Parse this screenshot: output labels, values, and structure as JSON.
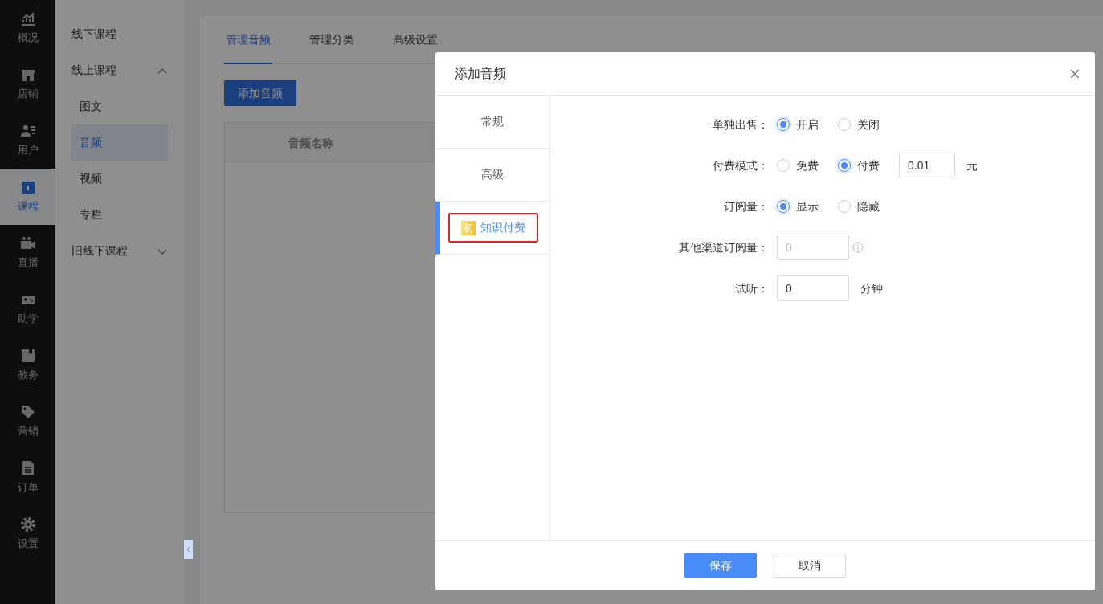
{
  "nav_rail": {
    "items": [
      {
        "label": "概况",
        "selected": false
      },
      {
        "label": "店铺",
        "selected": false
      },
      {
        "label": "用户",
        "selected": false
      },
      {
        "label": "课程",
        "selected": true
      },
      {
        "label": "直播",
        "selected": false
      },
      {
        "label": "助学",
        "selected": false
      },
      {
        "label": "教务",
        "selected": false
      },
      {
        "label": "营销",
        "selected": false
      },
      {
        "label": "订单",
        "selected": false
      },
      {
        "label": "设置",
        "selected": false
      }
    ]
  },
  "sub_menu": {
    "items": [
      {
        "label": "线下课程",
        "selected": false
      },
      {
        "label": "线上课程",
        "selected": false,
        "expanded": true,
        "children": [
          {
            "label": "图文",
            "selected": false
          },
          {
            "label": "音频",
            "selected": true
          },
          {
            "label": "视频",
            "selected": false
          },
          {
            "label": "专栏",
            "selected": false
          }
        ]
      },
      {
        "label": "旧线下课程",
        "selected": false,
        "expanded": false
      }
    ]
  },
  "main": {
    "tabs": [
      {
        "label": "管理音频",
        "selected": true
      },
      {
        "label": "管理分类",
        "selected": false
      },
      {
        "label": "高级设置",
        "selected": false
      }
    ],
    "add_button": "添加音频",
    "table": {
      "columns": [
        "音频名称"
      ]
    }
  },
  "dialog": {
    "title": "添加音频",
    "close": "×",
    "tabs": [
      {
        "label": "常规",
        "selected": false,
        "highlighted": false
      },
      {
        "label": "高级",
        "selected": false,
        "highlighted": false
      },
      {
        "label": "知识付费",
        "selected": true,
        "highlighted": true,
        "badge": "初"
      }
    ],
    "fields": [
      {
        "kind": "radio",
        "label": "单独出售：",
        "options": [
          {
            "label": "开启",
            "selected": true
          },
          {
            "label": "关闭",
            "selected": false
          }
        ]
      },
      {
        "kind": "radio",
        "label": "付费模式：",
        "options": [
          {
            "label": "免费",
            "selected": false
          },
          {
            "label": "付费",
            "selected": true
          }
        ],
        "value": "0.01",
        "unit": "元"
      },
      {
        "kind": "radio",
        "label": "订阅量：",
        "options": [
          {
            "label": "显示",
            "selected": true
          },
          {
            "label": "隐藏",
            "selected": false
          }
        ]
      },
      {
        "kind": "input",
        "label": "其他渠道订阅量：",
        "value": "0",
        "disabled": true,
        "info": true
      },
      {
        "kind": "input",
        "label": "试听：",
        "value": "0",
        "disabled": false,
        "unit": "分钟"
      }
    ],
    "buttons": [
      {
        "label": "保存",
        "kind": "primary"
      },
      {
        "label": "取消",
        "kind": "secondary"
      }
    ]
  }
}
